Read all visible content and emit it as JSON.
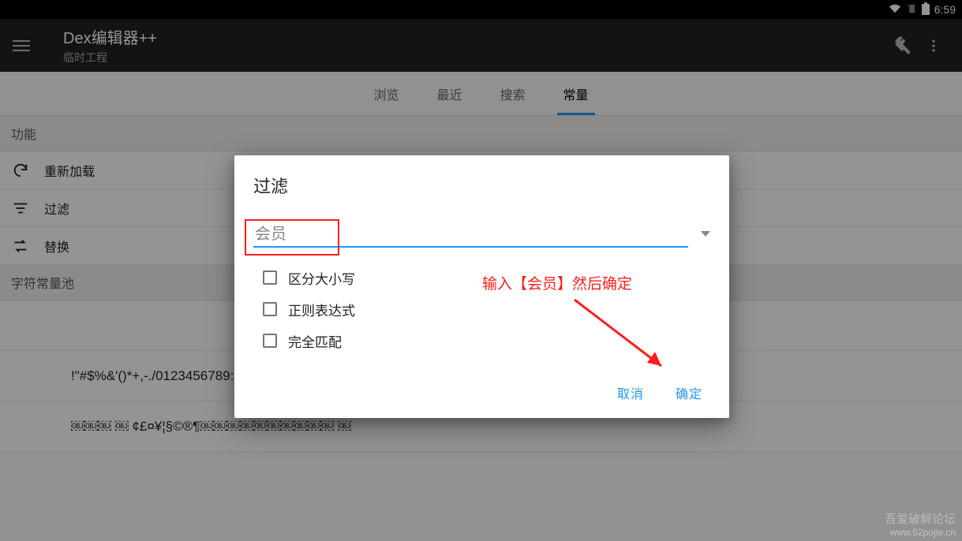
{
  "status": {
    "time": "6:59"
  },
  "appbar": {
    "title": "Dex编辑器++",
    "subtitle": "临时工程"
  },
  "tabs": [
    "浏览",
    "最近",
    "搜索",
    "常量"
  ],
  "active_tab": 3,
  "section_label": "功能",
  "actions": [
    {
      "icon": "refresh",
      "label": "重新加载"
    },
    {
      "icon": "filter",
      "label": "过滤"
    },
    {
      "icon": "swap",
      "label": "替换"
    }
  ],
  "pool_header": "字符常量池",
  "pool_items": [
    "",
    " !\"#$%&'()*+,-./0123456789:;<=>?",
    "￼￼￼  ￼ ¢£¤¥¦§©®¶￼￼￼￼￼￼￼￼￼￼ ￼"
  ],
  "dialog": {
    "title": "过滤",
    "input_value": "会员",
    "options": [
      "区分大小写",
      "正则表达式",
      "完全匹配"
    ],
    "cancel": "取消",
    "ok": "确定"
  },
  "annotation": {
    "hint": "输入【会员】然后确定"
  },
  "watermark": {
    "line1": "吾爱破解论坛",
    "line2": "www.52pojie.cn"
  }
}
